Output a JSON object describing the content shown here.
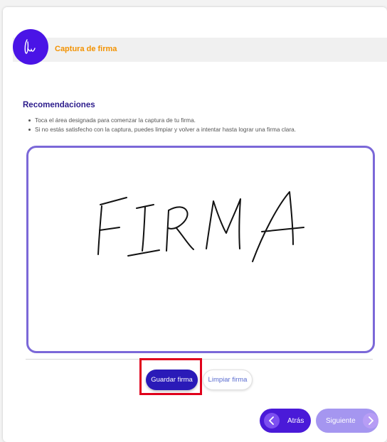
{
  "header": {
    "title": "Captura de firma",
    "logo_icon": "signature-icon",
    "title_color": "#f39200",
    "logo_color": "#4a14e6"
  },
  "recommendations": {
    "title": "Recomendaciones",
    "items": [
      "Toca el área designada para comenzar la captura de tu firma.",
      "Si no estás satisfecho con la captura, puedes limpiar y volver a intentar hasta lograr una firma clara."
    ]
  },
  "signature_pad": {
    "border_color": "#7b68d8",
    "content": "FIRMA"
  },
  "actions": {
    "save_label": "Guardar firma",
    "clear_label": "Limpiar firma"
  },
  "navigation": {
    "back_label": "Atrás",
    "next_label": "Siguiente",
    "back_icon": "chevron-left-icon",
    "next_icon": "chevron-right-icon"
  },
  "colors": {
    "primary": "#2a1ab8",
    "highlight": "#e0001b"
  }
}
